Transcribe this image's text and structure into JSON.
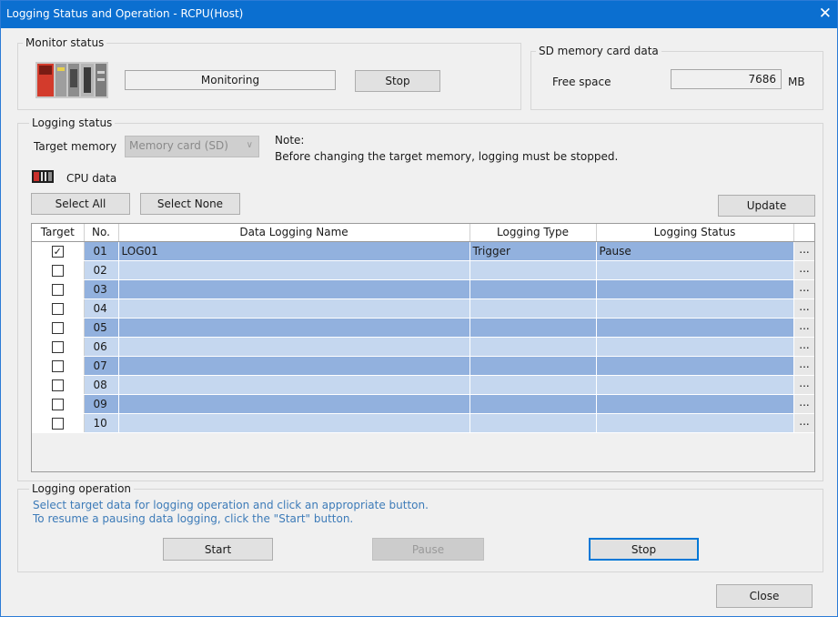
{
  "window": {
    "title": "Logging Status and Operation - RCPU(Host)",
    "close_glyph": "✕"
  },
  "monitor": {
    "group_label": "Monitor status",
    "status_text": "Monitoring",
    "stop_label": "Stop",
    "icon": "plc-cpu-module-icon"
  },
  "sd_card": {
    "group_label": "SD memory card data",
    "free_space_label": "Free space",
    "free_space_value": "7686",
    "unit": "MB"
  },
  "logging_status": {
    "group_label": "Logging status",
    "target_memory_label": "Target memory",
    "target_memory_value": "Memory card (SD)",
    "note_title": "Note:",
    "note_text": "Before changing the target memory, logging must be stopped.",
    "cpu_data_label": "CPU data",
    "cpu_icon": "cpu-module-icon",
    "select_all_label": "Select All",
    "select_none_label": "Select None",
    "update_label": "Update"
  },
  "table": {
    "headers": [
      "Target",
      "No.",
      "Data Logging Name",
      "Logging Type",
      "Logging Status"
    ],
    "rows": [
      {
        "checked": true,
        "no": "01",
        "name": "LOG01",
        "type": "Trigger",
        "status": "Pause",
        "more": "..."
      },
      {
        "checked": false,
        "no": "02",
        "name": "",
        "type": "",
        "status": "",
        "more": "..."
      },
      {
        "checked": false,
        "no": "03",
        "name": "",
        "type": "",
        "status": "",
        "more": "..."
      },
      {
        "checked": false,
        "no": "04",
        "name": "",
        "type": "",
        "status": "",
        "more": "..."
      },
      {
        "checked": false,
        "no": "05",
        "name": "",
        "type": "",
        "status": "",
        "more": "..."
      },
      {
        "checked": false,
        "no": "06",
        "name": "",
        "type": "",
        "status": "",
        "more": "..."
      },
      {
        "checked": false,
        "no": "07",
        "name": "",
        "type": "",
        "status": "",
        "more": "..."
      },
      {
        "checked": false,
        "no": "08",
        "name": "",
        "type": "",
        "status": "",
        "more": "..."
      },
      {
        "checked": false,
        "no": "09",
        "name": "",
        "type": "",
        "status": "",
        "more": "..."
      },
      {
        "checked": false,
        "no": "10",
        "name": "",
        "type": "",
        "status": "",
        "more": "..."
      }
    ]
  },
  "logging_operation": {
    "group_label": "Logging operation",
    "hint_line1": "Select target data for logging operation and click an appropriate button.",
    "hint_line2": "To resume a pausing data logging, click the \"Start\" button.",
    "start_label": "Start",
    "pause_label": "Pause",
    "stop_label": "Stop"
  },
  "footer": {
    "close_label": "Close"
  },
  "colors": {
    "title_bar": "#0b6fd0",
    "row_dark": "#92b1de",
    "row_light": "#c5d7ef",
    "hint_text": "#3d7bb8"
  }
}
